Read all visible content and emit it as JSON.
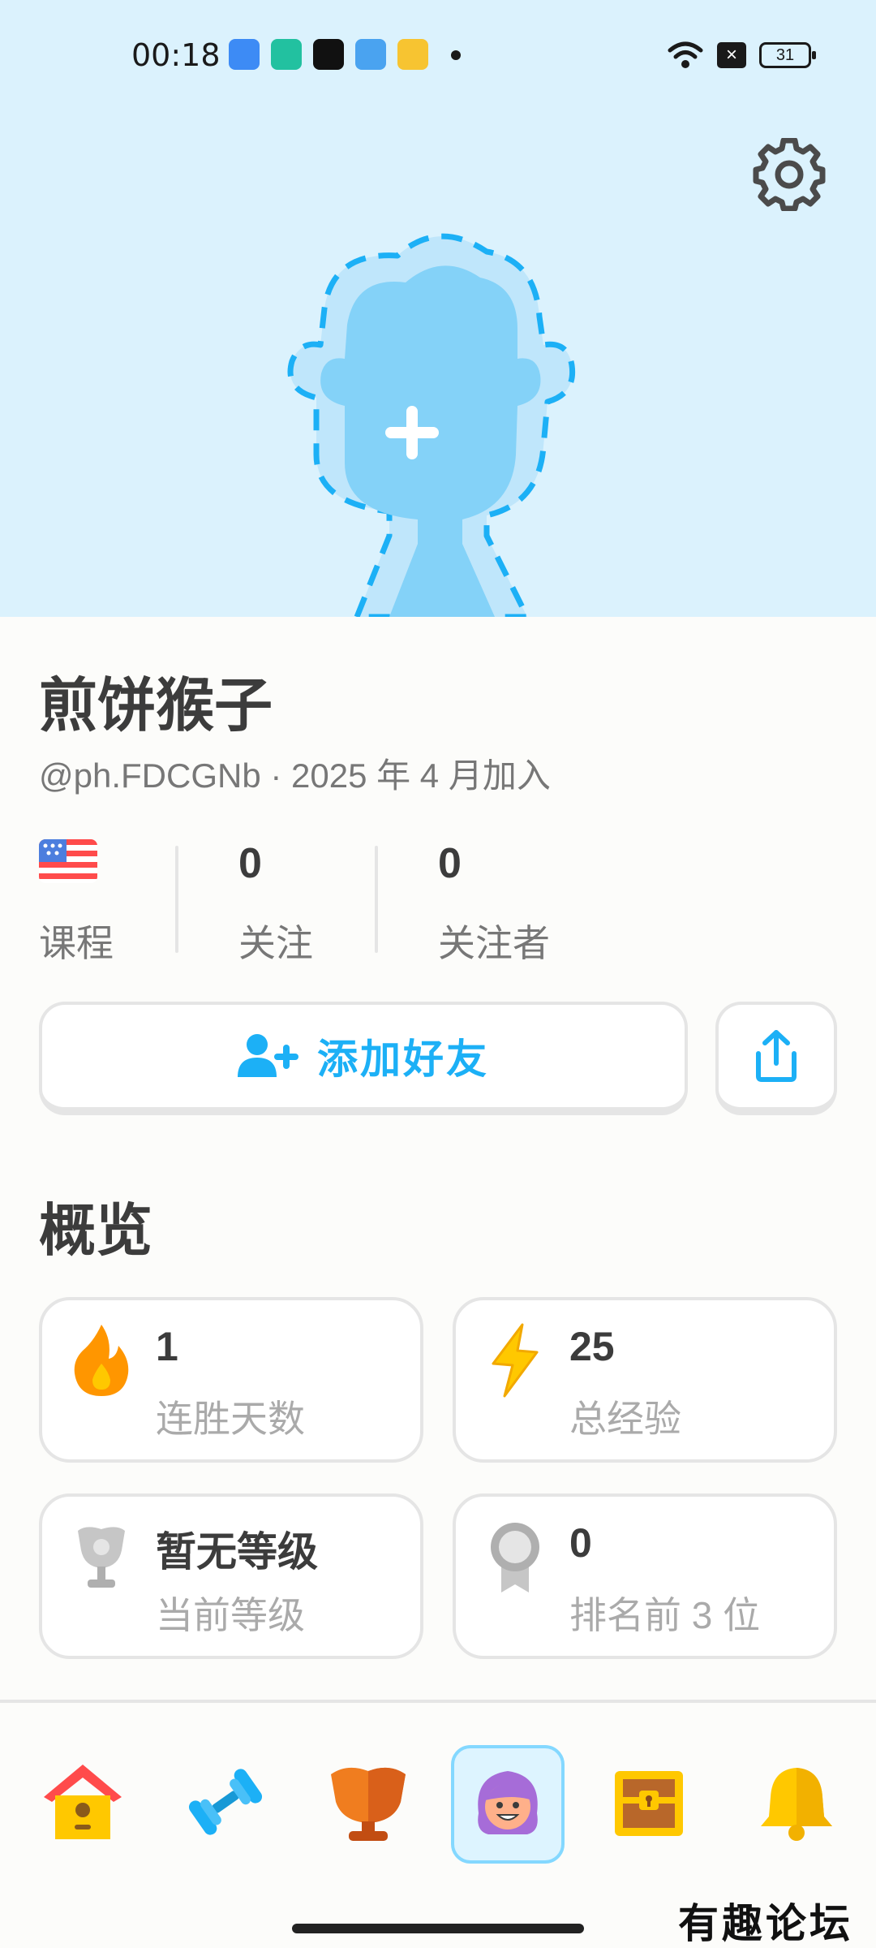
{
  "status_bar": {
    "time": "00:18",
    "battery": "31"
  },
  "profile": {
    "name": "煎饼猴子",
    "handle_line": "@ph.FDCGNb · 2025 年 4 月加入"
  },
  "stats": {
    "course_label": "课程",
    "following_count": "0",
    "following_label": "关注",
    "followers_count": "0",
    "followers_label": "关注者"
  },
  "actions": {
    "add_friend_label": "添加好友"
  },
  "overview": {
    "title": "概览",
    "cards": [
      {
        "value": "1",
        "label": "连胜天数",
        "icon": "flame-icon"
      },
      {
        "value": "25",
        "label": "总经验",
        "icon": "lightning-icon"
      },
      {
        "value": "暂无等级",
        "label": "当前等级",
        "icon": "trophy-icon"
      },
      {
        "value": "0",
        "label": "排名前 3 位",
        "icon": "medal-icon"
      }
    ]
  },
  "tabs": [
    "home-icon",
    "dumbbell-icon",
    "league-trophy-icon",
    "profile-icon",
    "treasure-chest-icon",
    "bell-icon"
  ],
  "watermark": "有趣论坛",
  "colors": {
    "accent": "#1cb0f6",
    "header_bg": "#dbf2fd",
    "flame": "#ff9600",
    "xp": "#ffc800"
  }
}
